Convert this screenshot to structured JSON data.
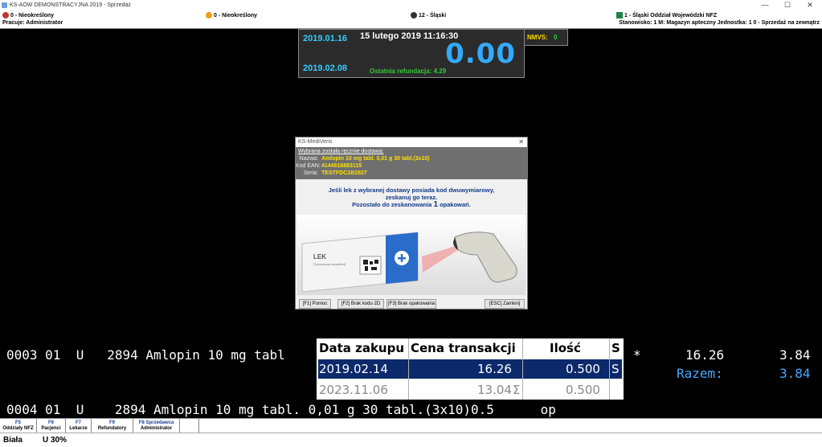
{
  "window": {
    "title": "KS-AOW DEMONSTRACYJNA 2019 - Sprzedaż",
    "min": "—",
    "max": "☐",
    "close": "✕"
  },
  "infobar": {
    "item1": "0 - Nieokreślony",
    "item2": "0 - Nieokreślony",
    "item3": "12 - Śląski",
    "item4": "1 - Śląski Oddział Wojewódzki NFZ",
    "user": "Pracuje: Administrator",
    "station": "Stanowisko: 1   M: Magazyn apteczny   Jednostka: 1   0 - Sprzedaż na zewnątrz"
  },
  "display": {
    "date_top": "2019.01.16",
    "datetime": "15 lutego 2019  11:16:30",
    "amount": "0.00",
    "date_bottom": "2019.02.08",
    "refund": "Ostatnia refundacja: 4.29"
  },
  "nmvs": {
    "label": "NMVS:",
    "value": "0"
  },
  "dialog": {
    "title": "KS-MediVeris",
    "close": "✕",
    "header": "Wybrana została ręcznie dostawa:",
    "name_label": "Nazwa:",
    "name_value": "Amlopin 10 mg tabl. 0,01 g 30 tabl.(3x10)",
    "ean_label": "Kod EAN:",
    "ean_value": "4144616883115",
    "series_label": "Seria:",
    "series_value": "TESTFDC1B2827",
    "msg1": "Jeśli lek z wybranej dostawy posiada kod dwuwymiarowy,",
    "msg2": "zeskanuj go teraz.",
    "msg3a": "Pozostało do zeskanowania",
    "msg3n": "1",
    "msg3b": "opakowań.",
    "box_title": "LEK",
    "box_sub": "[Tymczasowa nazwa/test]",
    "btn_help": "[F1] Pomoc",
    "btn_no2d": "[F2] Brak kodu 2D",
    "btn_nopack": "[F3] Brak opakowania",
    "btn_close": "[ESC] Zamknij"
  },
  "lines": {
    "line3": "0003 01  U   2894 Amlopin 10 mg tabl",
    "line3_star": "*",
    "line3_price": "16.26",
    "line3_value": "3.84",
    "total_label": "Razem:",
    "total_value": "3.84",
    "line4": "0004 01  U    2894 Amlopin 10 mg tabl. 0,01 g 30 tabl.(3x10)0.5      op"
  },
  "popup": {
    "headers": [
      "Data zakupu",
      "Cena transakcji",
      "Ilość",
      "S"
    ],
    "rows": [
      {
        "date": "2019.02.14",
        "price": "16.26",
        "mark": "",
        "qty": "0.500",
        "s": "S"
      },
      {
        "date": "2023.11.06",
        "price": "13.04",
        "mark": "Σ",
        "qty": "0.500",
        "s": ""
      }
    ]
  },
  "fkeys": [
    {
      "key": "F5",
      "label": "Oddziały NFZ"
    },
    {
      "key": "F6",
      "label": "Pacjenci"
    },
    {
      "key": "F7",
      "label": "Lekarze"
    },
    {
      "key": "F9",
      "label": "Refundatory"
    },
    {
      "key": "F8 Sprzedawca",
      "label": "Administrator"
    }
  ],
  "status": {
    "left": "Biała",
    "right": "U 30%"
  },
  "colors": {
    "cyan": "#33ccff",
    "green": "#33cc33",
    "selected": "#0c2a6b"
  }
}
